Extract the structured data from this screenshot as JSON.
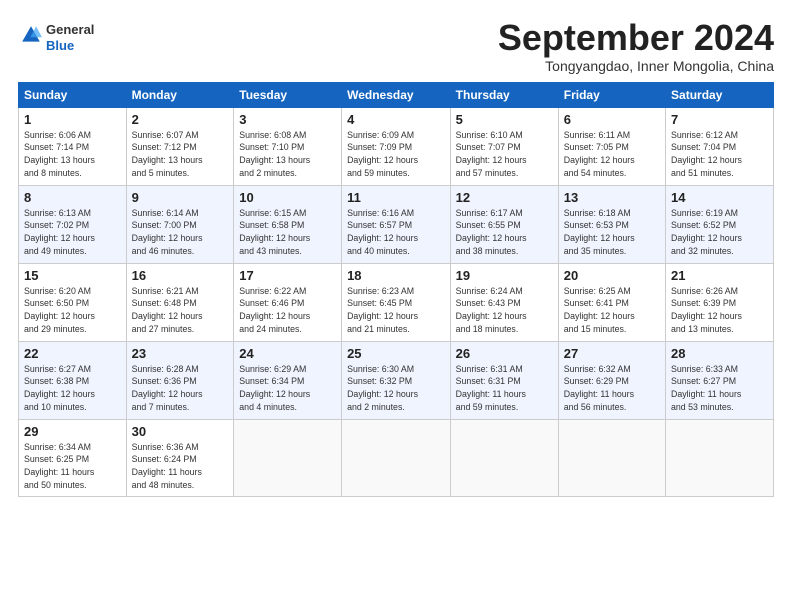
{
  "header": {
    "logo_line1": "General",
    "logo_line2": "Blue",
    "month": "September 2024",
    "location": "Tongyangdao, Inner Mongolia, China"
  },
  "weekdays": [
    "Sunday",
    "Monday",
    "Tuesday",
    "Wednesday",
    "Thursday",
    "Friday",
    "Saturday"
  ],
  "rows": [
    [
      {
        "day": "1",
        "info": "Sunrise: 6:06 AM\nSunset: 7:14 PM\nDaylight: 13 hours\nand 8 minutes."
      },
      {
        "day": "2",
        "info": "Sunrise: 6:07 AM\nSunset: 7:12 PM\nDaylight: 13 hours\nand 5 minutes."
      },
      {
        "day": "3",
        "info": "Sunrise: 6:08 AM\nSunset: 7:10 PM\nDaylight: 13 hours\nand 2 minutes."
      },
      {
        "day": "4",
        "info": "Sunrise: 6:09 AM\nSunset: 7:09 PM\nDaylight: 12 hours\nand 59 minutes."
      },
      {
        "day": "5",
        "info": "Sunrise: 6:10 AM\nSunset: 7:07 PM\nDaylight: 12 hours\nand 57 minutes."
      },
      {
        "day": "6",
        "info": "Sunrise: 6:11 AM\nSunset: 7:05 PM\nDaylight: 12 hours\nand 54 minutes."
      },
      {
        "day": "7",
        "info": "Sunrise: 6:12 AM\nSunset: 7:04 PM\nDaylight: 12 hours\nand 51 minutes."
      }
    ],
    [
      {
        "day": "8",
        "info": "Sunrise: 6:13 AM\nSunset: 7:02 PM\nDaylight: 12 hours\nand 49 minutes."
      },
      {
        "day": "9",
        "info": "Sunrise: 6:14 AM\nSunset: 7:00 PM\nDaylight: 12 hours\nand 46 minutes."
      },
      {
        "day": "10",
        "info": "Sunrise: 6:15 AM\nSunset: 6:58 PM\nDaylight: 12 hours\nand 43 minutes."
      },
      {
        "day": "11",
        "info": "Sunrise: 6:16 AM\nSunset: 6:57 PM\nDaylight: 12 hours\nand 40 minutes."
      },
      {
        "day": "12",
        "info": "Sunrise: 6:17 AM\nSunset: 6:55 PM\nDaylight: 12 hours\nand 38 minutes."
      },
      {
        "day": "13",
        "info": "Sunrise: 6:18 AM\nSunset: 6:53 PM\nDaylight: 12 hours\nand 35 minutes."
      },
      {
        "day": "14",
        "info": "Sunrise: 6:19 AM\nSunset: 6:52 PM\nDaylight: 12 hours\nand 32 minutes."
      }
    ],
    [
      {
        "day": "15",
        "info": "Sunrise: 6:20 AM\nSunset: 6:50 PM\nDaylight: 12 hours\nand 29 minutes."
      },
      {
        "day": "16",
        "info": "Sunrise: 6:21 AM\nSunset: 6:48 PM\nDaylight: 12 hours\nand 27 minutes."
      },
      {
        "day": "17",
        "info": "Sunrise: 6:22 AM\nSunset: 6:46 PM\nDaylight: 12 hours\nand 24 minutes."
      },
      {
        "day": "18",
        "info": "Sunrise: 6:23 AM\nSunset: 6:45 PM\nDaylight: 12 hours\nand 21 minutes."
      },
      {
        "day": "19",
        "info": "Sunrise: 6:24 AM\nSunset: 6:43 PM\nDaylight: 12 hours\nand 18 minutes."
      },
      {
        "day": "20",
        "info": "Sunrise: 6:25 AM\nSunset: 6:41 PM\nDaylight: 12 hours\nand 15 minutes."
      },
      {
        "day": "21",
        "info": "Sunrise: 6:26 AM\nSunset: 6:39 PM\nDaylight: 12 hours\nand 13 minutes."
      }
    ],
    [
      {
        "day": "22",
        "info": "Sunrise: 6:27 AM\nSunset: 6:38 PM\nDaylight: 12 hours\nand 10 minutes."
      },
      {
        "day": "23",
        "info": "Sunrise: 6:28 AM\nSunset: 6:36 PM\nDaylight: 12 hours\nand 7 minutes."
      },
      {
        "day": "24",
        "info": "Sunrise: 6:29 AM\nSunset: 6:34 PM\nDaylight: 12 hours\nand 4 minutes."
      },
      {
        "day": "25",
        "info": "Sunrise: 6:30 AM\nSunset: 6:32 PM\nDaylight: 12 hours\nand 2 minutes."
      },
      {
        "day": "26",
        "info": "Sunrise: 6:31 AM\nSunset: 6:31 PM\nDaylight: 11 hours\nand 59 minutes."
      },
      {
        "day": "27",
        "info": "Sunrise: 6:32 AM\nSunset: 6:29 PM\nDaylight: 11 hours\nand 56 minutes."
      },
      {
        "day": "28",
        "info": "Sunrise: 6:33 AM\nSunset: 6:27 PM\nDaylight: 11 hours\nand 53 minutes."
      }
    ],
    [
      {
        "day": "29",
        "info": "Sunrise: 6:34 AM\nSunset: 6:25 PM\nDaylight: 11 hours\nand 50 minutes."
      },
      {
        "day": "30",
        "info": "Sunrise: 6:36 AM\nSunset: 6:24 PM\nDaylight: 11 hours\nand 48 minutes."
      },
      {
        "day": "",
        "info": ""
      },
      {
        "day": "",
        "info": ""
      },
      {
        "day": "",
        "info": ""
      },
      {
        "day": "",
        "info": ""
      },
      {
        "day": "",
        "info": ""
      }
    ]
  ]
}
